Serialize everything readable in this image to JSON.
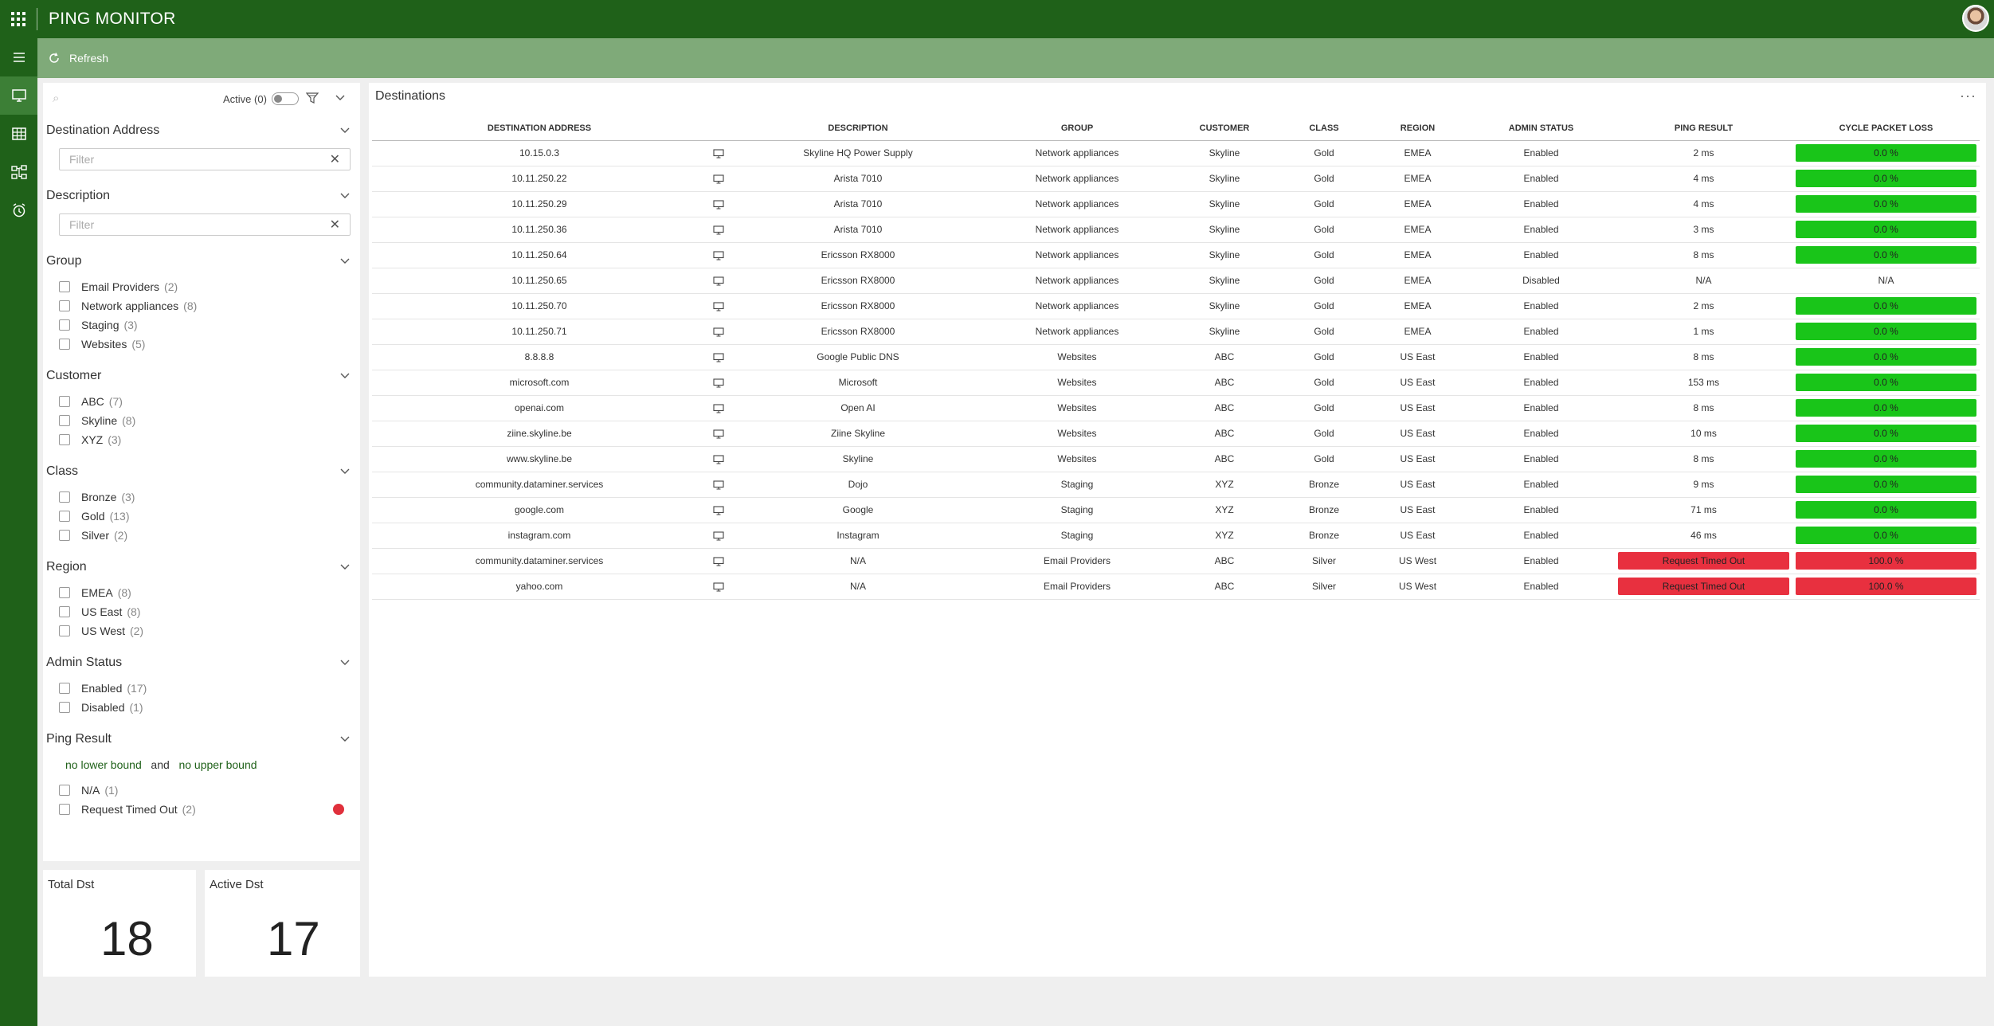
{
  "app": {
    "title": "PING MONITOR"
  },
  "toolbar": {
    "refresh_label": "Refresh"
  },
  "filters": {
    "active_label": "Active (0)",
    "destination_address": {
      "title": "Destination Address",
      "placeholder": "Filter"
    },
    "description": {
      "title": "Description",
      "placeholder": "Filter"
    },
    "group": {
      "title": "Group",
      "options": [
        {
          "label": "Email Providers",
          "count": "(2)"
        },
        {
          "label": "Network appliances",
          "count": "(8)"
        },
        {
          "label": "Staging",
          "count": "(3)"
        },
        {
          "label": "Websites",
          "count": "(5)"
        }
      ]
    },
    "customer": {
      "title": "Customer",
      "options": [
        {
          "label": "ABC",
          "count": "(7)"
        },
        {
          "label": "Skyline",
          "count": "(8)"
        },
        {
          "label": "XYZ",
          "count": "(3)"
        }
      ]
    },
    "class": {
      "title": "Class",
      "options": [
        {
          "label": "Bronze",
          "count": "(3)"
        },
        {
          "label": "Gold",
          "count": "(13)"
        },
        {
          "label": "Silver",
          "count": "(2)"
        }
      ]
    },
    "region": {
      "title": "Region",
      "options": [
        {
          "label": "EMEA",
          "count": "(8)"
        },
        {
          "label": "US East",
          "count": "(8)"
        },
        {
          "label": "US West",
          "count": "(2)"
        }
      ]
    },
    "admin_status": {
      "title": "Admin Status",
      "options": [
        {
          "label": "Enabled",
          "count": "(17)"
        },
        {
          "label": "Disabled",
          "count": "(1)"
        }
      ]
    },
    "ping_result": {
      "title": "Ping Result",
      "lower": "no lower bound",
      "and": "and",
      "upper": "no upper bound",
      "options": [
        {
          "label": "N/A",
          "count": "(1)"
        },
        {
          "label": "Request Timed Out",
          "count": "(2)"
        }
      ]
    }
  },
  "kpis": {
    "total": {
      "label": "Total Dst",
      "value": "18"
    },
    "active": {
      "label": "Active Dst",
      "value": "17"
    }
  },
  "destinations": {
    "title": "Destinations",
    "more": "···",
    "columns": [
      "DESTINATION ADDRESS",
      "DESCRIPTION",
      "GROUP",
      "CUSTOMER",
      "CLASS",
      "REGION",
      "ADMIN STATUS",
      "PING RESULT",
      "CYCLE PACKET LOSS"
    ],
    "rows": [
      {
        "address": "10.15.0.3",
        "description": "Skyline HQ Power Supply",
        "group": "Network appliances",
        "customer": "Skyline",
        "class": "Gold",
        "region": "EMEA",
        "admin": "Enabled",
        "ping": "2 ms",
        "loss": "0.0 %"
      },
      {
        "address": "10.11.250.22",
        "description": "Arista 7010",
        "group": "Network appliances",
        "customer": "Skyline",
        "class": "Gold",
        "region": "EMEA",
        "admin": "Enabled",
        "ping": "4 ms",
        "loss": "0.0 %"
      },
      {
        "address": "10.11.250.29",
        "description": "Arista 7010",
        "group": "Network appliances",
        "customer": "Skyline",
        "class": "Gold",
        "region": "EMEA",
        "admin": "Enabled",
        "ping": "4 ms",
        "loss": "0.0 %"
      },
      {
        "address": "10.11.250.36",
        "description": "Arista 7010",
        "group": "Network appliances",
        "customer": "Skyline",
        "class": "Gold",
        "region": "EMEA",
        "admin": "Enabled",
        "ping": "3 ms",
        "loss": "0.0 %"
      },
      {
        "address": "10.11.250.64",
        "description": "Ericsson RX8000",
        "group": "Network appliances",
        "customer": "Skyline",
        "class": "Gold",
        "region": "EMEA",
        "admin": "Enabled",
        "ping": "8 ms",
        "loss": "0.0 %"
      },
      {
        "address": "10.11.250.65",
        "description": "Ericsson RX8000",
        "group": "Network appliances",
        "customer": "Skyline",
        "class": "Gold",
        "region": "EMEA",
        "admin": "Disabled",
        "ping": "N/A",
        "loss": "N/A"
      },
      {
        "address": "10.11.250.70",
        "description": "Ericsson RX8000",
        "group": "Network appliances",
        "customer": "Skyline",
        "class": "Gold",
        "region": "EMEA",
        "admin": "Enabled",
        "ping": "2 ms",
        "loss": "0.0 %"
      },
      {
        "address": "10.11.250.71",
        "description": "Ericsson RX8000",
        "group": "Network appliances",
        "customer": "Skyline",
        "class": "Gold",
        "region": "EMEA",
        "admin": "Enabled",
        "ping": "1 ms",
        "loss": "0.0 %"
      },
      {
        "address": "8.8.8.8",
        "description": "Google Public DNS",
        "group": "Websites",
        "customer": "ABC",
        "class": "Gold",
        "region": "US East",
        "admin": "Enabled",
        "ping": "8 ms",
        "loss": "0.0 %"
      },
      {
        "address": "microsoft.com",
        "description": "Microsoft",
        "group": "Websites",
        "customer": "ABC",
        "class": "Gold",
        "region": "US East",
        "admin": "Enabled",
        "ping": "153 ms",
        "loss": "0.0 %"
      },
      {
        "address": "openai.com",
        "description": "Open AI",
        "group": "Websites",
        "customer": "ABC",
        "class": "Gold",
        "region": "US East",
        "admin": "Enabled",
        "ping": "8 ms",
        "loss": "0.0 %"
      },
      {
        "address": "ziine.skyline.be",
        "description": "Ziine Skyline",
        "group": "Websites",
        "customer": "ABC",
        "class": "Gold",
        "region": "US East",
        "admin": "Enabled",
        "ping": "10 ms",
        "loss": "0.0 %"
      },
      {
        "address": "www.skyline.be",
        "description": "Skyline",
        "group": "Websites",
        "customer": "ABC",
        "class": "Gold",
        "region": "US East",
        "admin": "Enabled",
        "ping": "8 ms",
        "loss": "0.0 %"
      },
      {
        "address": "community.dataminer.services",
        "description": "Dojo",
        "group": "Staging",
        "customer": "XYZ",
        "class": "Bronze",
        "region": "US East",
        "admin": "Enabled",
        "ping": "9 ms",
        "loss": "0.0 %"
      },
      {
        "address": "google.com",
        "description": "Google",
        "group": "Staging",
        "customer": "XYZ",
        "class": "Bronze",
        "region": "US East",
        "admin": "Enabled",
        "ping": "71 ms",
        "loss": "0.0 %"
      },
      {
        "address": "instagram.com",
        "description": "Instagram",
        "group": "Staging",
        "customer": "XYZ",
        "class": "Bronze",
        "region": "US East",
        "admin": "Enabled",
        "ping": "46 ms",
        "loss": "0.0 %"
      },
      {
        "address": "community.dataminer.services",
        "description": "N/A",
        "group": "Email Providers",
        "customer": "ABC",
        "class": "Silver",
        "region": "US West",
        "admin": "Enabled",
        "ping": "Request Timed Out",
        "loss": "100.0 %"
      },
      {
        "address": "yahoo.com",
        "description": "N/A",
        "group": "Email Providers",
        "customer": "ABC",
        "class": "Silver",
        "region": "US West",
        "admin": "Enabled",
        "ping": "Request Timed Out",
        "loss": "100.0 %"
      }
    ]
  },
  "colors": {
    "header": "#1f6119",
    "toolbar": "#7faa79",
    "ok": "#19c519",
    "bad": "#e8303f"
  }
}
